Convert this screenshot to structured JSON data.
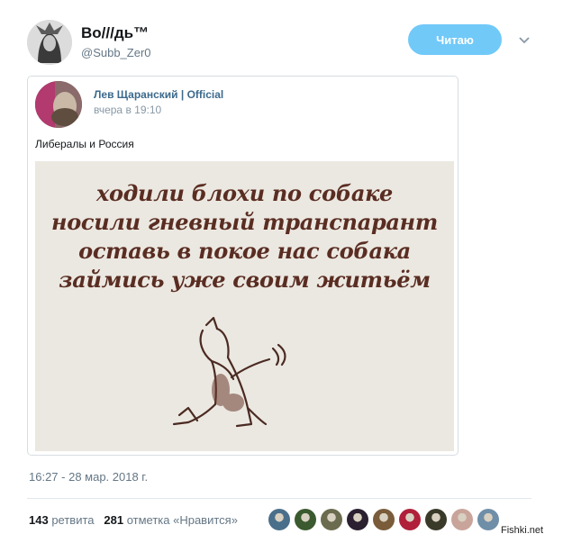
{
  "tweet": {
    "author_name": "Во///дь™",
    "author_handle": "@Subb_Zer0",
    "follow_label": "Читаю",
    "timestamp": "16:27 - 28 мар. 2018 г.",
    "retweet_count": "143",
    "retweet_label": "ретвита",
    "like_count": "281",
    "like_label": "отметка «Нравится»"
  },
  "quoted": {
    "author_name": "Лев Щаранский | Official",
    "time": "вчера в 19:10",
    "text": "Либералы и Россия",
    "image_lines": [
      "ходили блохи по собаке",
      "носили гневный транспарант",
      "оставь в покое нас собака",
      "займись уже своим житьём"
    ]
  },
  "likers": [
    {
      "color": "#4a6f8a"
    },
    {
      "color": "#3b5a2f"
    },
    {
      "color": "#6b6b4f"
    },
    {
      "color": "#2a2030"
    },
    {
      "color": "#7a5c3a"
    },
    {
      "color": "#b0203a"
    },
    {
      "color": "#3a3a2a"
    },
    {
      "color": "#c9a49a"
    },
    {
      "color": "#6f8ea8"
    }
  ],
  "watermark": "Fishki.net",
  "colors": {
    "follow_button": "#71c9f8",
    "link_blue": "#3c6a8d",
    "meta_gray": "#657786"
  }
}
